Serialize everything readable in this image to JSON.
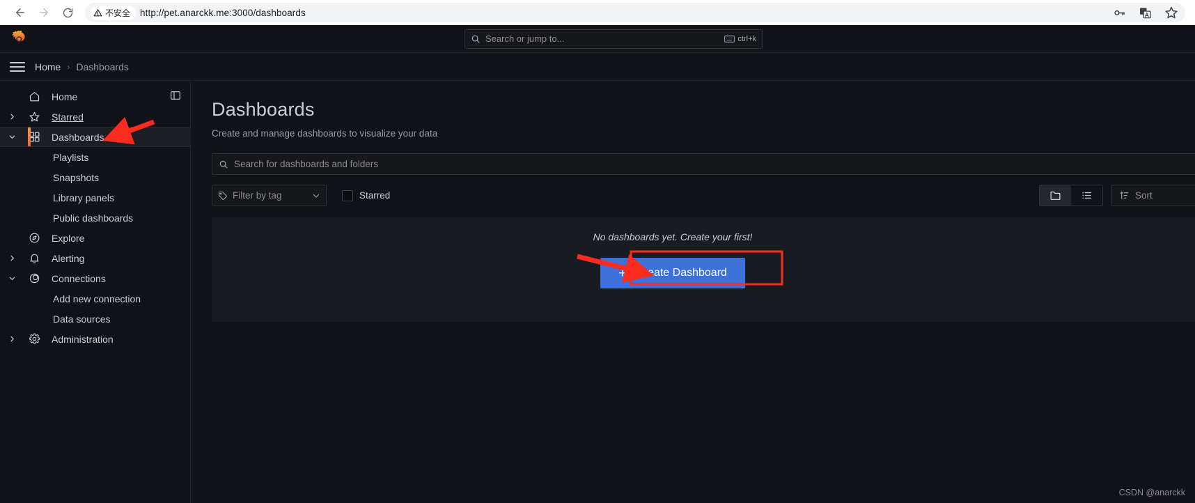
{
  "browser": {
    "back_icon": "arrow-left-icon",
    "forward_icon": "arrow-right-icon",
    "reload_icon": "reload-icon",
    "security_label": "不安全",
    "security_icon": "warning-triangle-icon",
    "url": "http://pet.anarckk.me:3000/dashboards",
    "password_icon": "key-icon",
    "translate_icon": "translate-icon",
    "bookmark_icon": "star-outline-icon"
  },
  "grafana_header": {
    "logo_icon": "grafana-logo-icon",
    "search_icon": "search-icon",
    "search_placeholder": "Search or jump to...",
    "keyboard_icon": "keyboard-icon",
    "shortcut": "ctrl+k"
  },
  "breadcrumb": {
    "menu_icon": "hamburger-menu-icon",
    "home": "Home",
    "separator": "›",
    "current": "Dashboards"
  },
  "sidebar": {
    "dock_icon": "dock-menu-icon",
    "items": [
      {
        "label": "Home",
        "icon": "home-icon",
        "chevron": "",
        "level": "top",
        "state": ""
      },
      {
        "label": "Starred",
        "icon": "star-icon",
        "chevron": "right",
        "level": "top",
        "state": "hovered"
      },
      {
        "label": "Dashboards",
        "icon": "dashboards-grid-icon",
        "chevron": "down",
        "level": "top",
        "state": "active"
      },
      {
        "label": "Playlists",
        "icon": "",
        "chevron": "",
        "level": "child",
        "state": ""
      },
      {
        "label": "Snapshots",
        "icon": "",
        "chevron": "",
        "level": "child",
        "state": ""
      },
      {
        "label": "Library panels",
        "icon": "",
        "chevron": "",
        "level": "child",
        "state": ""
      },
      {
        "label": "Public dashboards",
        "icon": "",
        "chevron": "",
        "level": "child",
        "state": ""
      },
      {
        "label": "Explore",
        "icon": "compass-icon",
        "chevron": "",
        "level": "top",
        "state": ""
      },
      {
        "label": "Alerting",
        "icon": "bell-icon",
        "chevron": "right",
        "level": "top",
        "state": ""
      },
      {
        "label": "Connections",
        "icon": "connections-icon",
        "chevron": "down",
        "level": "top",
        "state": ""
      },
      {
        "label": "Add new connection",
        "icon": "",
        "chevron": "",
        "level": "child",
        "state": ""
      },
      {
        "label": "Data sources",
        "icon": "",
        "chevron": "",
        "level": "child",
        "state": ""
      },
      {
        "label": "Administration",
        "icon": "gear-icon",
        "chevron": "right",
        "level": "top",
        "state": ""
      }
    ]
  },
  "main": {
    "title": "Dashboards",
    "subtitle": "Create and manage dashboards to visualize your data",
    "search": {
      "icon": "search-icon",
      "placeholder": "Search for dashboards and folders",
      "value": ""
    },
    "filters": {
      "tag_icon": "tag-icon",
      "tag_label": "Filter by tag",
      "tag_chevron_icon": "chevron-down-icon",
      "starred_label": "Starred",
      "starred_checked": false
    },
    "view_toggle": {
      "folder_icon": "folder-icon",
      "list_icon": "list-icon",
      "active": "folder"
    },
    "sort": {
      "icon": "sort-amount-up-icon",
      "label": "Sort"
    },
    "empty_state": {
      "message": "No dashboards yet. Create your first!",
      "button_label": "Create Dashboard",
      "button_plus": "+",
      "button_color": "#3d71d9"
    }
  },
  "watermark": "CSDN @anarckk",
  "annotations": {
    "arrow_color": "#fb2c1f",
    "arrow_sidebar_target": "Dashboards",
    "arrow_button_target": "Create Dashboard"
  }
}
